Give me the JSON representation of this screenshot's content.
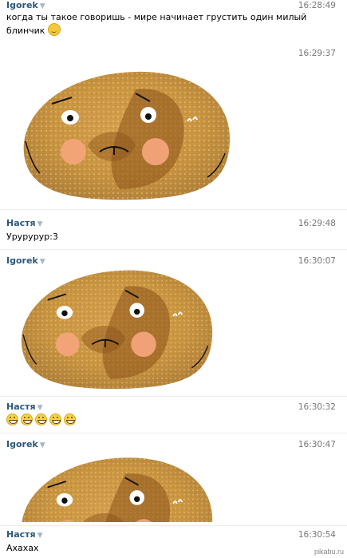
{
  "messages": [
    {
      "sender": "Igorek",
      "time": "16:28:49",
      "text": "когда ты такое говоришь - мире начинает грустить один милый",
      "text2": "блинчик"
    },
    {
      "time": "16:29:37"
    },
    {
      "sender": "Настя",
      "time": "16:29:48",
      "text": "Урурурур:3"
    },
    {
      "sender": "Igorek",
      "time": "16:30:07"
    },
    {
      "sender": "Настя",
      "time": "16:30:32"
    },
    {
      "sender": "Igorek",
      "time": "16:30:47"
    },
    {
      "sender": "Настя",
      "time": "16:30:54",
      "text": "Ахахах"
    }
  ],
  "sender_arrow": "▼",
  "watermark": "pikabu.ru",
  "icons": {
    "relieved": "relieved-face-emoji",
    "grin": "grinning-face-emoji"
  },
  "colors": {
    "sender": "#2b587a",
    "time": "#777777",
    "pancake": "#d9a04a"
  }
}
